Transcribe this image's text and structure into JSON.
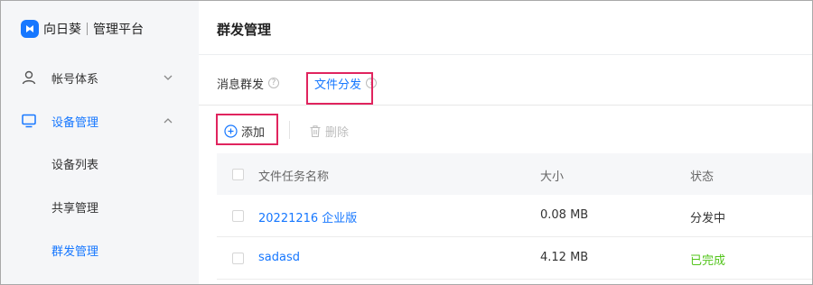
{
  "brand": {
    "name": "向日葵",
    "subtitle": "管理平台",
    "color": "#1677ff"
  },
  "sidebar": {
    "items": [
      {
        "label": "帐号体系",
        "icon": "user-icon",
        "expanded": false
      },
      {
        "label": "设备管理",
        "icon": "monitor-icon",
        "expanded": true,
        "active": true
      }
    ],
    "subitems": [
      {
        "label": "设备列表"
      },
      {
        "label": "共享管理"
      },
      {
        "label": "群发管理",
        "active": true
      }
    ]
  },
  "header": {
    "title": "群发管理"
  },
  "tabs": [
    {
      "label": "消息群发",
      "active": false
    },
    {
      "label": "文件分发",
      "active": true
    }
  ],
  "toolbar": {
    "add_label": "添加",
    "delete_label": "删除"
  },
  "table": {
    "columns": [
      "文件任务名称",
      "大小",
      "状态"
    ],
    "rows": [
      {
        "name": "20221216 企业版",
        "size": "0.08 MB",
        "status": "分发中",
        "status_color": "#333333"
      },
      {
        "name": "sadasd",
        "size": "4.12 MB",
        "status": "已完成",
        "status_color": "#52c41a"
      }
    ]
  },
  "colors": {
    "accent": "#1677ff",
    "highlight": "#e0245e",
    "success": "#52c41a"
  }
}
